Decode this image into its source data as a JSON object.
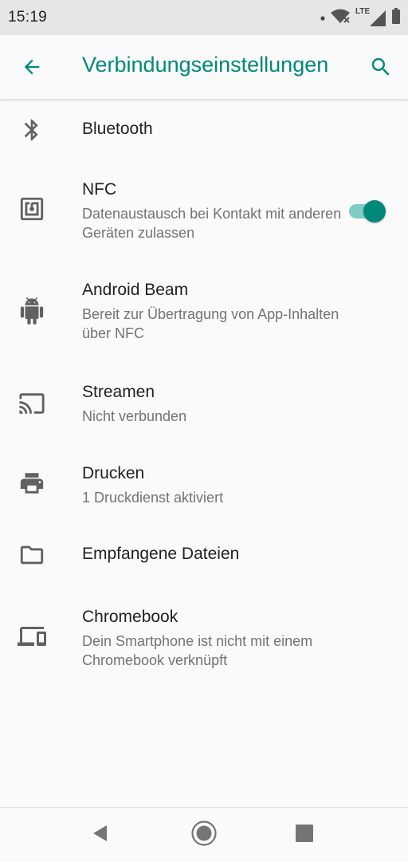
{
  "status_bar": {
    "time": "15:19",
    "network_label": "LTE",
    "icons": [
      "notification-dot-icon",
      "wifi-off-icon",
      "lte-signal-icon",
      "battery-icon"
    ]
  },
  "toolbar": {
    "title": "Verbindungseinstellungen",
    "back_icon": "arrow-back-icon",
    "search_icon": "search-icon",
    "accent_color": "#00897b"
  },
  "items": [
    {
      "icon": "bluetooth-icon",
      "label": "Bluetooth",
      "summary": ""
    },
    {
      "icon": "nfc-icon",
      "label": "NFC",
      "summary": "Datenaustausch bei Kontakt mit anderen Geräten zulassen",
      "toggle": "on"
    },
    {
      "icon": "android-icon",
      "label": "Android Beam",
      "summary": "Bereit zur Übertragung von App-Inhalten über NFC"
    },
    {
      "icon": "cast-icon",
      "label": "Streamen",
      "summary": "Nicht verbunden"
    },
    {
      "icon": "print-icon",
      "label": "Drucken",
      "summary": "1 Druckdienst aktiviert"
    },
    {
      "icon": "folder-icon",
      "label": "Empfangene Dateien",
      "summary": ""
    },
    {
      "icon": "devices-icon",
      "label": "Chromebook",
      "summary": "Dein Smartphone ist nicht mit einem Chromebook verknüpft"
    }
  ],
  "nav_bar": {
    "buttons": [
      "back-triangle-icon",
      "home-circle-icon",
      "recents-square-icon"
    ]
  }
}
